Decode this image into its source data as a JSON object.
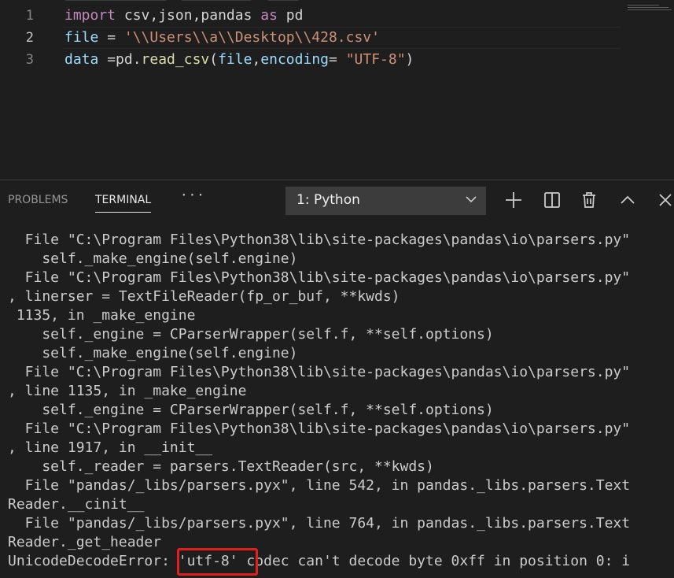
{
  "editor": {
    "lines": [
      {
        "number": "1",
        "tokens": [
          {
            "text": "import",
            "kind": "kw"
          },
          {
            "text": " csv,json,pandas ",
            "kind": "pl"
          },
          {
            "text": "as",
            "kind": "kw"
          },
          {
            "text": " pd",
            "kind": "pl"
          }
        ]
      },
      {
        "number": "2",
        "tokens": [
          {
            "text": "file",
            "kind": "var"
          },
          {
            "text": " = ",
            "kind": "pl"
          },
          {
            "text": "'\\\\Users\\\\a\\\\Desktop\\\\428.csv'",
            "kind": "str"
          }
        ]
      },
      {
        "number": "3",
        "tokens": [
          {
            "text": "data",
            "kind": "var"
          },
          {
            "text": " =pd.",
            "kind": "pl"
          },
          {
            "text": "read_csv",
            "kind": "fn"
          },
          {
            "text": "(",
            "kind": "pl"
          },
          {
            "text": "file",
            "kind": "var"
          },
          {
            "text": ",",
            "kind": "pl"
          },
          {
            "text": "encoding",
            "kind": "var"
          },
          {
            "text": "= ",
            "kind": "pl"
          },
          {
            "text": "\"UTF-8\"",
            "kind": "str"
          },
          {
            "text": ")",
            "kind": "pl"
          }
        ]
      }
    ]
  },
  "panel": {
    "tabs": [
      {
        "label": "PROBLEMS",
        "active": false
      },
      {
        "label": "TERMINAL",
        "active": true
      }
    ],
    "more_label": "···",
    "terminal_select": "1: Python",
    "icons": [
      "plus-icon",
      "split-icon",
      "trash-icon",
      "chevron-up-icon",
      "close-icon"
    ]
  },
  "terminal": {
    "lines": [
      "  File \"C:\\Program Files\\Python38\\lib\\site-packages\\pandas\\io\\parsers.py\"",
      "    self._make_engine(self.engine)",
      "  File \"C:\\Program Files\\Python38\\lib\\site-packages\\pandas\\io\\parsers.py\"",
      ", linerser = TextFileReader(fp_or_buf, **kwds)",
      " 1135, in _make_engine",
      "    self._engine = CParserWrapper(self.f, **self.options)",
      "    self._make_engine(self.engine)",
      "  File \"C:\\Program Files\\Python38\\lib\\site-packages\\pandas\\io\\parsers.py\"",
      ", line 1135, in _make_engine",
      "    self._engine = CParserWrapper(self.f, **self.options)",
      "  File \"C:\\Program Files\\Python38\\lib\\site-packages\\pandas\\io\\parsers.py\"",
      ", line 1917, in __init__",
      "    self._reader = parsers.TextReader(src, **kwds)",
      "  File \"pandas/_libs/parsers.pyx\", line 542, in pandas._libs.parsers.Text",
      "Reader.__cinit__",
      "  File \"pandas/_libs/parsers.pyx\", line 764, in pandas._libs.parsers.Text",
      "Reader._get_header",
      "UnicodeDecodeError: 'utf-8' codec can't decode byte 0xff in position 0: i"
    ]
  }
}
